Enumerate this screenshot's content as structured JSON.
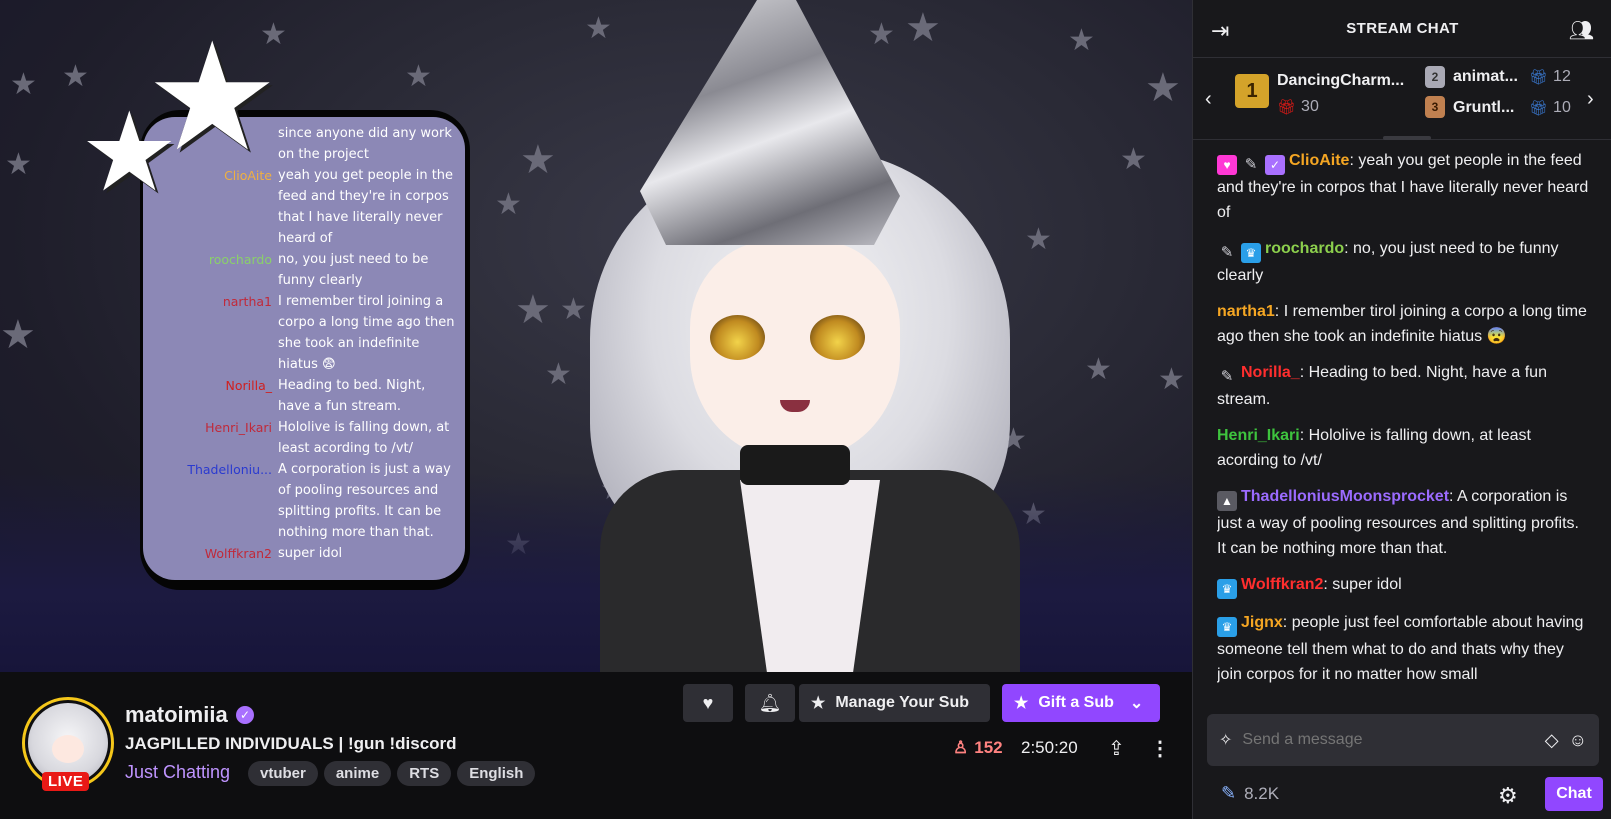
{
  "video": {
    "overlay_chat": [
      {
        "name": "",
        "name_color": "#ffffff",
        "text": "since anyone did any work"
      },
      {
        "name": "",
        "name_color": "#ffffff",
        "text": "on the project"
      },
      {
        "name": "ClioAite",
        "name_color": "#f0b040",
        "text": "yeah you get people in the feed and they're in corpos that I have literally never heard of"
      },
      {
        "name": "roochardo",
        "name_color": "#8ad06a",
        "text": "no, you just need to be funny clearly"
      },
      {
        "name": "nartha1",
        "name_color": "#c02a3a",
        "text": "I remember tirol joining a corpo a long time ago then she took an indefinite hiatus 😨"
      },
      {
        "name": "Norilla_",
        "name_color": "#d02020",
        "text": "Heading to bed. Night, have a fun stream."
      },
      {
        "name": "Henri_Ikari",
        "name_color": "#c02a3a",
        "text": "Hololive is falling down, at least acording to /vt/"
      },
      {
        "name": "Thadelloniu...",
        "name_color": "#2a3ad0",
        "text": "A corporation is just a way of pooling resources and splitting profits. It can be nothing more than that."
      },
      {
        "name": "Wolffkran2",
        "name_color": "#c02a3a",
        "text": "super idol"
      }
    ]
  },
  "channel": {
    "name": "matoimiia",
    "live_label": "LIVE",
    "title": "JAGPILLED INDIVIDUALS | !gun !discord",
    "category": "Just Chatting",
    "tags": [
      "vtuber",
      "anime",
      "RTS",
      "English"
    ],
    "viewers": "152",
    "uptime": "2:50:20",
    "manage_sub_label": "Manage Your Sub",
    "gift_sub_label": "Gift a Sub"
  },
  "chat": {
    "title": "STREAM CHAT",
    "leaderboard": {
      "first": {
        "rank": "1",
        "name": "DancingCharm...",
        "count": "30"
      },
      "second": {
        "rank": "2",
        "name": "animat...",
        "count": "12"
      },
      "third": {
        "rank": "3",
        "name": "Gruntl...",
        "count": "10"
      }
    },
    "messages": [
      {
        "badges": [
          "pink",
          "plain",
          "purple"
        ],
        "user": "ClioAite",
        "color": "#f5a623",
        "text": "yeah you get people in the feed and they're in corpos that I have literally never heard of"
      },
      {
        "badges": [
          "plain",
          "blue"
        ],
        "user": "roochardo",
        "color": "#8ccf4d",
        "text": "no, you just need to be funny clearly"
      },
      {
        "badges": [],
        "user": "nartha1",
        "color": "#f5a623",
        "text": "I remember tirol joining a corpo a long time ago then she took an indefinite hiatus 😨"
      },
      {
        "badges": [
          "plain"
        ],
        "user": "Norilla_",
        "color": "#ff2e2e",
        "text": "Heading to bed. Night, have a fun stream."
      },
      {
        "badges": [],
        "user": "Henri_Ikari",
        "color": "#3ec43e",
        "text": "Hololive is falling down, at least acording to /vt/"
      },
      {
        "badges": [
          "gray"
        ],
        "user": "ThadelloniusMoonsprocket",
        "color": "#9b6bff",
        "text": "A corporation is just a way of pooling resources and splitting profits. It can be nothing more than that."
      },
      {
        "badges": [
          "blue"
        ],
        "user": "Wolffkran2",
        "color": "#ff2e2e",
        "text": "super idol"
      },
      {
        "badges": [
          "blue"
        ],
        "user": "Jignx",
        "color": "#f5a623",
        "text": "people just feel comfortable about having someone tell them what to do and thats why they join corpos for it no matter how small"
      }
    ],
    "input_placeholder": "Send a message",
    "bits": "8.2K",
    "chat_button": "Chat"
  },
  "colors": {
    "accent": "#9147ff",
    "live": "#e91916",
    "viewers": "#ff8280",
    "category": "#bf94ff"
  }
}
